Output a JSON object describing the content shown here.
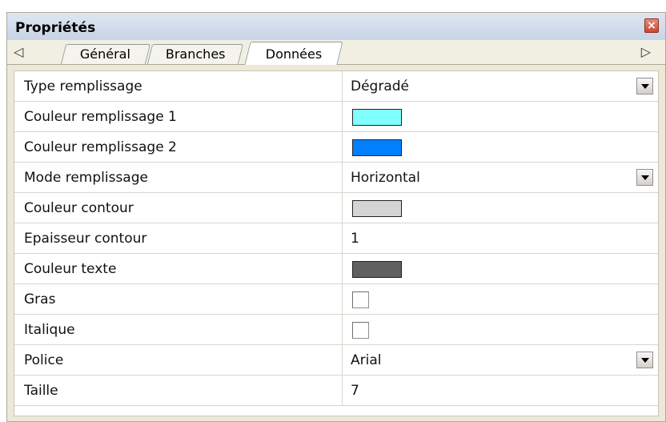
{
  "panel": {
    "title": "Propriétés",
    "close_icon": "close-icon"
  },
  "tabs": {
    "left_arrow": "◁",
    "right_arrow": "▷",
    "items": [
      {
        "label": "Général"
      },
      {
        "label": "Branches"
      },
      {
        "label": "Données",
        "active": true
      }
    ]
  },
  "properties": {
    "rows": [
      {
        "label": "Type remplissage",
        "type": "dropdown",
        "value": "Dégradé"
      },
      {
        "label": "Couleur remplissage 1",
        "type": "color",
        "color": "#80ffff"
      },
      {
        "label": "Couleur remplissage 2",
        "type": "color",
        "color": "#0080ff"
      },
      {
        "label": "Mode remplissage",
        "type": "dropdown",
        "value": "Horizontal"
      },
      {
        "label": "Couleur contour",
        "type": "color",
        "color": "#d4d4d4"
      },
      {
        "label": "Epaisseur contour",
        "type": "text",
        "value": "1"
      },
      {
        "label": "Couleur texte",
        "type": "color",
        "color": "#606060"
      },
      {
        "label": "Gras",
        "type": "checkbox",
        "checked": false
      },
      {
        "label": "Italique",
        "type": "checkbox",
        "checked": false
      },
      {
        "label": "Police",
        "type": "dropdown",
        "value": "Arial"
      },
      {
        "label": "Taille",
        "type": "text",
        "value": "7"
      }
    ]
  }
}
